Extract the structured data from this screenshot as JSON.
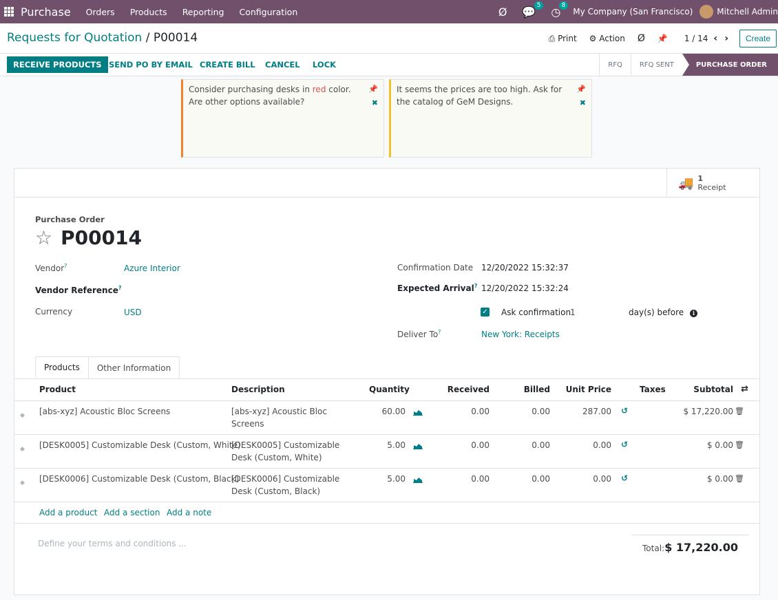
{
  "topbar": {
    "app_name": "Purchase",
    "menu": [
      "Orders",
      "Products",
      "Reporting",
      "Configuration"
    ],
    "messages_count": "5",
    "activities_count": "8",
    "company": "My Company (San Francisco)",
    "user": "Mitchell Admin"
  },
  "control_panel": {
    "breadcrumb_parent": "Requests for Quotation",
    "breadcrumb_sep": " / ",
    "breadcrumb_current": "P00014",
    "print_label": "Print",
    "action_label": "Action",
    "pager": "1 / 14",
    "create_label": "Create"
  },
  "statusbar": {
    "buttons": [
      "RECEIVE PRODUCTS",
      "SEND PO BY EMAIL",
      "CREATE BILL",
      "CANCEL",
      "LOCK"
    ],
    "stages": [
      "RFQ",
      "RFQ SENT",
      "PURCHASE ORDER"
    ],
    "active_stage": "PURCHASE ORDER"
  },
  "notes": [
    {
      "text_before": "Consider purchasing desks in ",
      "text_red": "red",
      "text_after": " color. Are other options available?",
      "accent": "#f0812d"
    },
    {
      "text": "It seems the prices are too high. Ask for the catalog of GeM Designs.",
      "accent": "#f2c12e"
    }
  ],
  "smart_button": {
    "count": "1",
    "label": "Receipt"
  },
  "form": {
    "label": "Purchase Order",
    "title": "P00014",
    "vendor_label": "Vendor",
    "vendor": "Azure Interior",
    "vendor_ref_label": "Vendor Reference",
    "currency_label": "Currency",
    "currency": "USD",
    "confirmation_label": "Confirmation Date",
    "confirmation_date": "12/20/2022 15:32:37",
    "expected_label": "Expected Arrival",
    "expected_date": "12/20/2022 15:32:24",
    "ask_confirmation_label": "Ask confirmation",
    "ask_confirmation_days": "1",
    "days_before_label": "day(s) before",
    "deliver_label": "Deliver To",
    "deliver_to": "New York: Receipts",
    "help_mark": "?"
  },
  "tabs": [
    "Products",
    "Other Information"
  ],
  "table": {
    "headers": [
      "Product",
      "Description",
      "Quantity",
      "Received",
      "Billed",
      "Unit Price",
      "Taxes",
      "Subtotal"
    ],
    "rows": [
      {
        "product": "[abs-xyz] Acoustic Bloc Screens",
        "desc1": "[abs-xyz] Acoustic Bloc",
        "desc2": "Screens",
        "qty": "60.00",
        "received": "0.00",
        "billed": "0.00",
        "price": "287.00",
        "subtotal": "$ 17,220.00"
      },
      {
        "product": "[DESK0005] Customizable Desk (Custom, White)",
        "desc1": "[DESK0005] Customizable",
        "desc2": "Desk (Custom, White)",
        "qty": "5.00",
        "received": "0.00",
        "billed": "0.00",
        "price": "0.00",
        "subtotal": "$ 0.00"
      },
      {
        "product": "[DESK0006] Customizable Desk (Custom, Black)",
        "desc1": "[DESK0006] Customizable",
        "desc2": "Desk (Custom, Black)",
        "qty": "5.00",
        "received": "0.00",
        "billed": "0.00",
        "price": "0.00",
        "subtotal": "$ 0.00"
      }
    ],
    "add_links": [
      "Add a product",
      "Add a section",
      "Add a note"
    ]
  },
  "footer": {
    "terms_placeholder": "Define your terms and conditions ...",
    "total_label": "Total:",
    "total_value": "$ 17,220.00"
  },
  "colors": {
    "brand": "#71506b",
    "accent": "#017e84"
  }
}
